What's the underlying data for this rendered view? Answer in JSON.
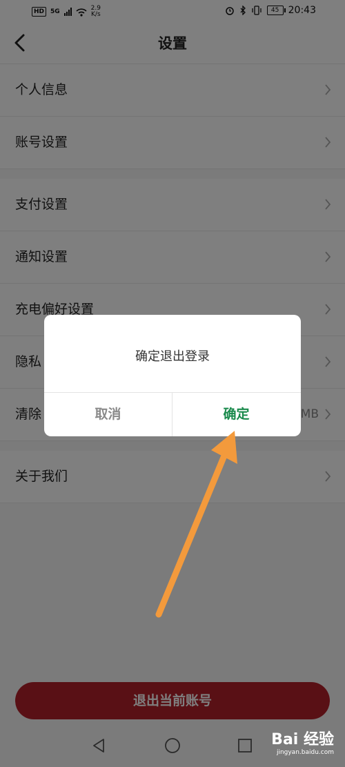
{
  "status_bar": {
    "hd": "HD",
    "network": "5G",
    "net_speed": "2.9",
    "net_unit": "K/s",
    "battery": "45",
    "time": "20:43"
  },
  "header": {
    "title": "设置"
  },
  "settings": {
    "items": [
      {
        "label": "个人信息",
        "value": ""
      },
      {
        "label": "账号设置",
        "value": ""
      },
      {
        "label": "支付设置",
        "value": ""
      },
      {
        "label": "通知设置",
        "value": ""
      },
      {
        "label": "充电偏好设置",
        "value": ""
      },
      {
        "label": "隐私",
        "value": ""
      },
      {
        "label": "清除",
        "value": "MB"
      },
      {
        "label": "关于我们",
        "value": ""
      }
    ]
  },
  "logout": {
    "label": "退出当前账号"
  },
  "dialog": {
    "message": "确定退出登录",
    "cancel_label": "取消",
    "confirm_label": "确定"
  },
  "watermark": {
    "logo": "Bai 经验",
    "url": "jingyan.baidu.com"
  },
  "colors": {
    "accent_red": "#b3212b",
    "confirm_green": "#1a8a4c",
    "annotation_orange": "#f39a3c"
  }
}
